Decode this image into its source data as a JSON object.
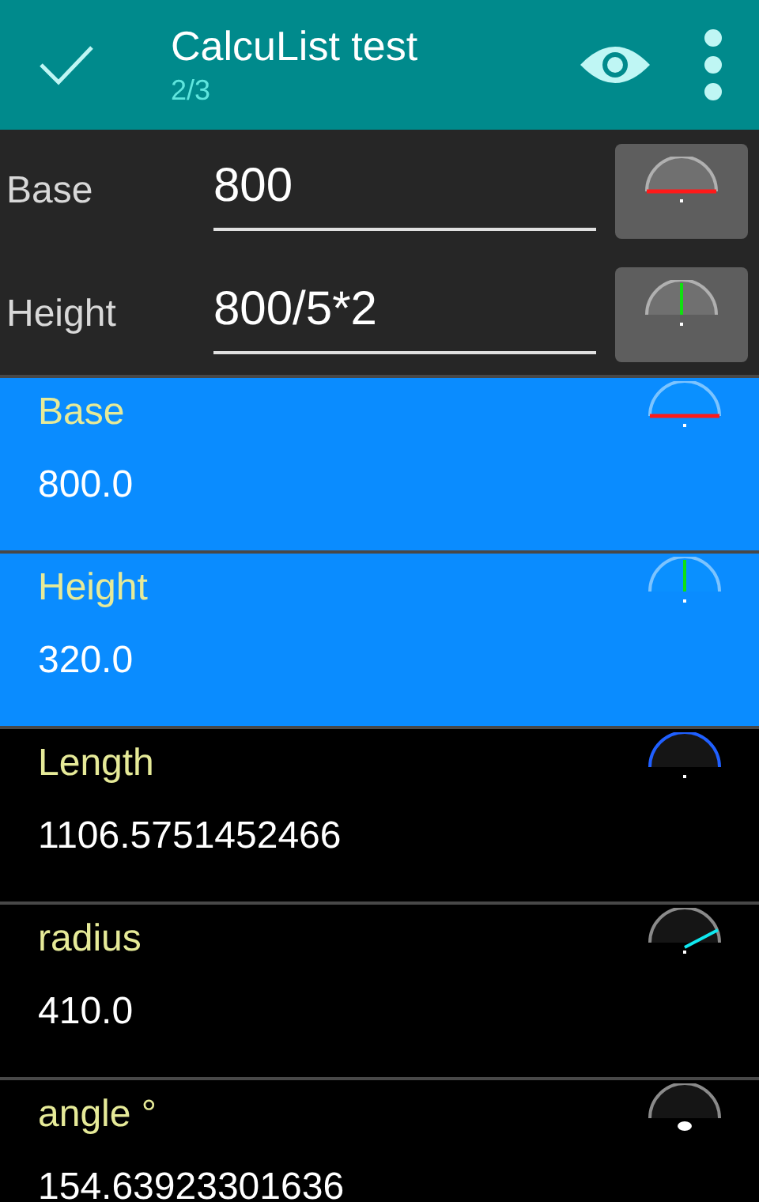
{
  "toolbar": {
    "title": "CalcuList test",
    "subtitle": "2/3"
  },
  "inputs": [
    {
      "label": "Base",
      "value": "800",
      "kind": "base"
    },
    {
      "label": "Height",
      "value": "800/5*2",
      "kind": "height"
    }
  ],
  "results": [
    {
      "name": "Base",
      "value": "800.0",
      "kind": "base",
      "selected": true
    },
    {
      "name": "Height",
      "value": "320.0",
      "kind": "height",
      "selected": true
    },
    {
      "name": "Length",
      "value": "1106.5751452466",
      "kind": "length",
      "selected": false
    },
    {
      "name": "radius",
      "value": "410.0",
      "kind": "radius",
      "selected": false
    },
    {
      "name": "angle °",
      "value": "154.63923301636",
      "kind": "angle",
      "selected": false
    }
  ]
}
